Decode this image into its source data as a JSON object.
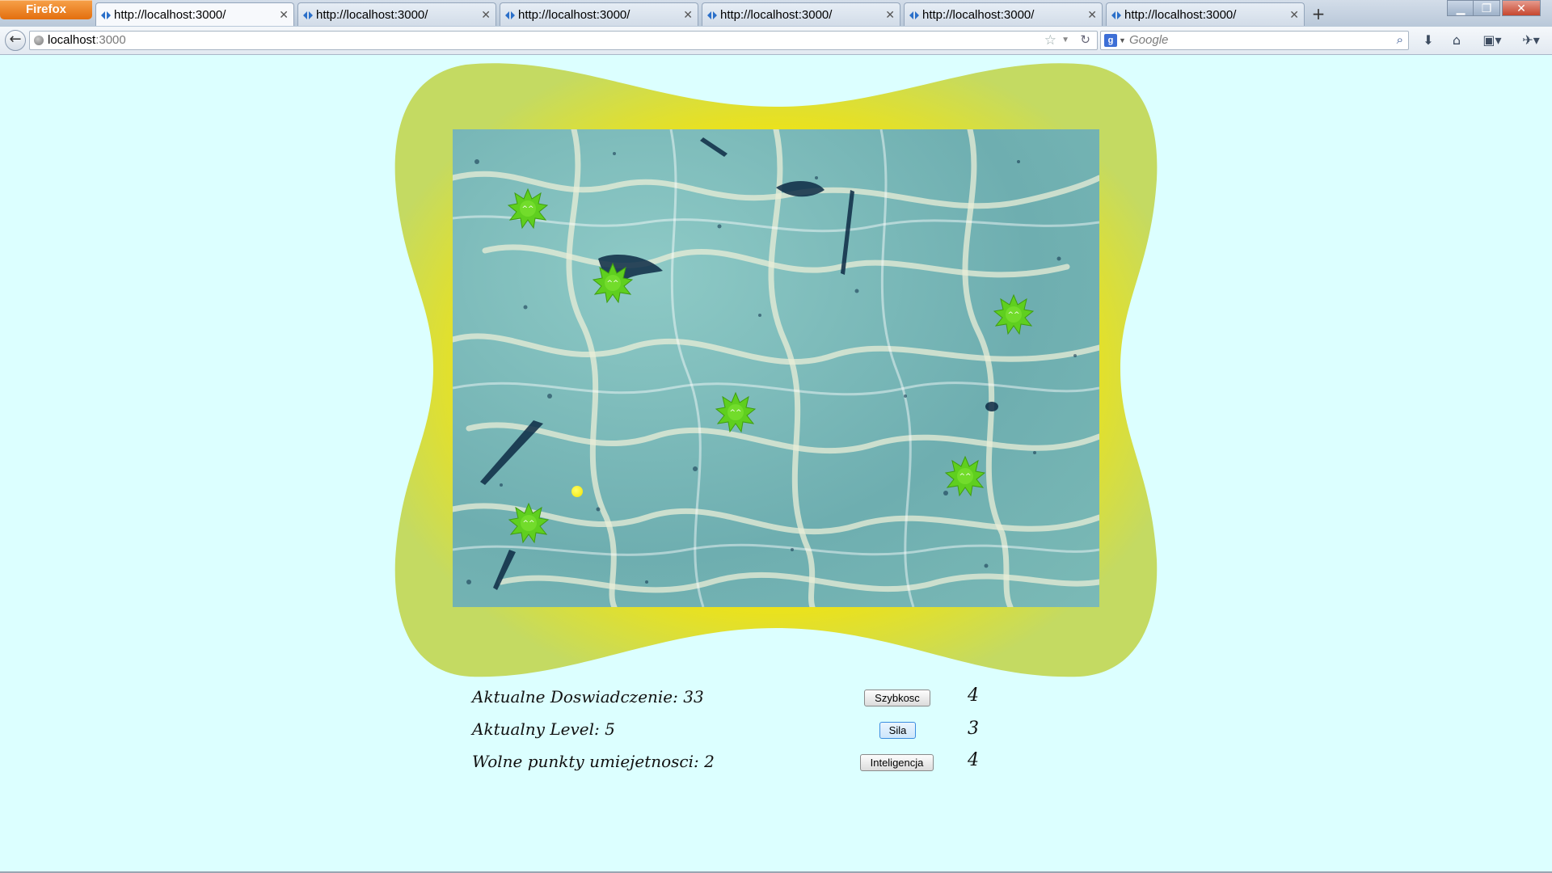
{
  "browser": {
    "app_button": "Firefox",
    "tabs": [
      {
        "title": "http://localhost:3000/"
      },
      {
        "title": "http://localhost:3000/"
      },
      {
        "title": "http://localhost:3000/"
      },
      {
        "title": "http://localhost:3000/"
      },
      {
        "title": "http://localhost:3000/"
      },
      {
        "title": "http://localhost:3000/"
      }
    ],
    "address": {
      "host": "localhost",
      "port": ":3000"
    },
    "search_placeholder": "Google"
  },
  "game": {
    "monster_face": "^^",
    "monster_color": "#5fcf1f",
    "player_color": "#f3e300",
    "frame_color": "#c4da62",
    "frame_glow": "#f2e313"
  },
  "stats": {
    "experience": "Aktualne Doswiadczenie: 33",
    "level": "Aktualny Level: 5",
    "free_points": "Wolne punkty umiejetnosci: 2"
  },
  "skills": [
    {
      "label": "Szybkosc",
      "value": "4"
    },
    {
      "label": "Sila",
      "value": "3"
    },
    {
      "label": "Inteligencja",
      "value": "4"
    }
  ]
}
